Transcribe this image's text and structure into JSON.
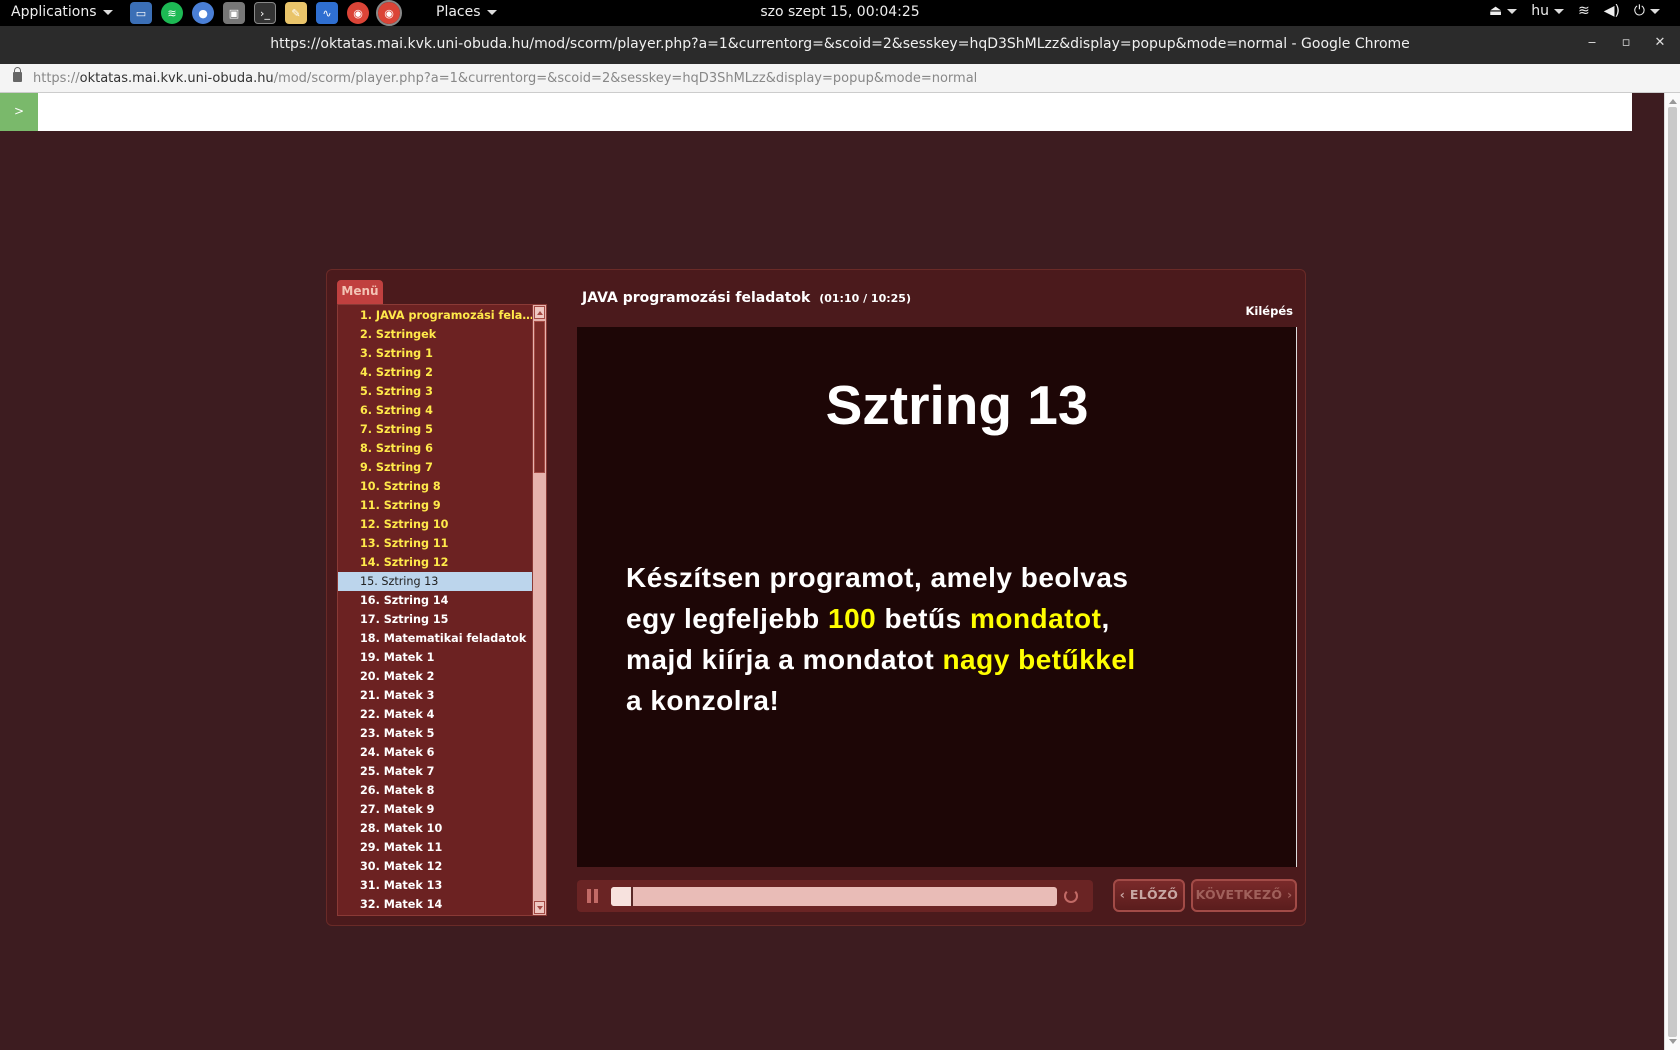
{
  "topbar": {
    "applications": "Applications",
    "places": "Places",
    "clock": "szo szept 15, 00:04:25",
    "keyboard_layout": "hu"
  },
  "window": {
    "title": "https://oktatas.mai.kvk.uni-obuda.hu/mod/scorm/player.php?a=1&currentorg=&scoid=2&sesskey=hqD3ShMLzz&display=popup&mode=normal - Google Chrome"
  },
  "urlbar": {
    "scheme": "https://",
    "host": "oktatas.mai.kvk.uni-obuda.hu",
    "path": "/mod/scorm/player.php?a=1&currentorg=&scoid=2&sesskey=hqD3ShMLzz&display=popup&mode=normal"
  },
  "page": {
    "toggle_label": ">"
  },
  "player": {
    "menu_tab": "Menü",
    "course_title": "JAVA programozási feladatok",
    "time": "(01:10 / 10:25)",
    "exit_label": "Kilépés",
    "progress_fraction": 0.05,
    "prev_label": "‹ ELŐZŐ",
    "next_label": "KÖVETKEZŐ ›",
    "menu_items": [
      {
        "label": "1. JAVA programozási felada...",
        "state": "done"
      },
      {
        "label": "2. Sztringek",
        "state": "done"
      },
      {
        "label": "3. Sztring 1",
        "state": "done"
      },
      {
        "label": "4. Sztring 2",
        "state": "done"
      },
      {
        "label": "5. Sztring 3",
        "state": "done"
      },
      {
        "label": "6. Sztring  4",
        "state": "done"
      },
      {
        "label": "7. Sztring 5",
        "state": "done"
      },
      {
        "label": "8. Sztring 6",
        "state": "done"
      },
      {
        "label": "9. Sztring 7",
        "state": "done"
      },
      {
        "label": "10. Sztring 8",
        "state": "done"
      },
      {
        "label": "11. Sztring 9",
        "state": "done"
      },
      {
        "label": "12. Sztring 10",
        "state": "done"
      },
      {
        "label": "13. Sztring 11",
        "state": "done"
      },
      {
        "label": "14. Sztring 12",
        "state": "done"
      },
      {
        "label": "15. Sztring 13",
        "state": "active"
      },
      {
        "label": "16. Sztring 14",
        "state": "todo"
      },
      {
        "label": "17. Sztring 15",
        "state": "todo"
      },
      {
        "label": "18. Matematikai feladatok",
        "state": "todo"
      },
      {
        "label": "19. Matek 1",
        "state": "todo"
      },
      {
        "label": "20. Matek 2",
        "state": "todo"
      },
      {
        "label": "21. Matek 3",
        "state": "todo"
      },
      {
        "label": "22. Matek 4",
        "state": "todo"
      },
      {
        "label": "23. Matek 5",
        "state": "todo"
      },
      {
        "label": "24. Matek 6",
        "state": "todo"
      },
      {
        "label": "25. Matek 7",
        "state": "todo"
      },
      {
        "label": "26. Matek 8",
        "state": "todo"
      },
      {
        "label": "27. Matek 9",
        "state": "todo"
      },
      {
        "label": "28. Matek 10",
        "state": "todo"
      },
      {
        "label": "29. Matek 11",
        "state": "todo"
      },
      {
        "label": "30. Matek 12",
        "state": "todo"
      },
      {
        "label": "31. Matek 13",
        "state": "todo"
      },
      {
        "label": "32. Matek 14",
        "state": "todo"
      }
    ]
  },
  "slide": {
    "title": "Sztring 13",
    "line1": "Készítsen programot, amely beolvas",
    "line2_a": "egy legfeljebb ",
    "line2_hl1": "100",
    "line2_b": " betűs ",
    "line2_hl2": "mondatot",
    "line2_c": ",",
    "line3_a": "majd kiírja a mondatot ",
    "line3_hl": "nagy betűkkel",
    "line4": "a konzolra!"
  }
}
